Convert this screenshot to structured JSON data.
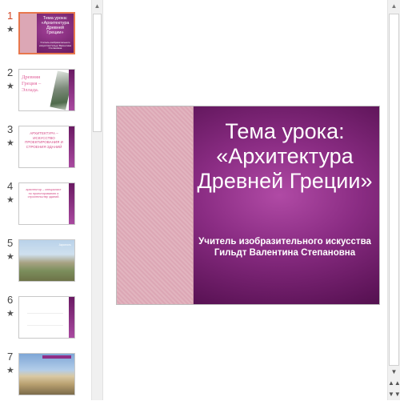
{
  "slides": [
    {
      "number": "1",
      "star": "★",
      "title": "Тема урока: «Архитектура Древней Греции»",
      "subtitle": "Учитель изобразительного искусства Гильдт Валентина Степановна"
    },
    {
      "number": "2",
      "star": "★",
      "text": "Древняя Греция – Эллада."
    },
    {
      "number": "3",
      "star": "★",
      "text": "АРХИТЕКТУРА – ИСКУССТВО ПРОЕКТИРОВАНИЯ И СТРОЕНИЯ ЗДАНИЙ"
    },
    {
      "number": "4",
      "star": "★",
      "text": "архитектор – специалист по проектированию и строительству зданий."
    },
    {
      "number": "5",
      "star": "★",
      "text": "Акрополь"
    },
    {
      "number": "6",
      "star": "★"
    },
    {
      "number": "7",
      "star": "★"
    }
  ],
  "main_slide": {
    "title": "Тема урока: «Архитектура Древней Греции»",
    "subtitle": "Учитель изобразительного искусства Гильдт Валентина Степановна"
  },
  "scrollbar_icons": {
    "up": "▲",
    "down": "▼",
    "prev_slide": "▲▲",
    "next_slide": "▼▼"
  },
  "colors": {
    "active_slide": "#d24726",
    "slide_bg": "#5d1458",
    "slide_band": "#dca7b5"
  }
}
